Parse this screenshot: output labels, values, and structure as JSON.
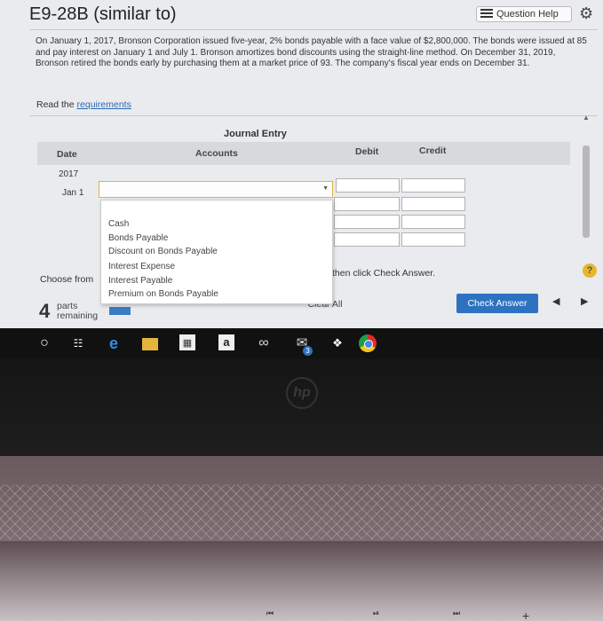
{
  "title": "E9-28B (similar to)",
  "question_help": "Question Help",
  "problem_text": "On January 1, 2017, Bronson Corporation issued five-year, 2% bonds payable with a face value of $2,800,000. The bonds were issued at 85 and pay interest on January 1 and July 1. Bronson amortizes bond discounts using the straight-line method. On December 31, 2019, Bronson retired the bonds early by purchasing them at a market price of 93. The company's fiscal year ends on December 31.",
  "read_prefix": "Read the",
  "read_link": "requirements",
  "journal": {
    "title": "Journal Entry",
    "col_date": "Date",
    "col_accounts": "Accounts",
    "col_debit": "Debit",
    "col_credit": "Credit",
    "year": "2017",
    "date": "Jan 1"
  },
  "dropdown_options": [
    "Cash",
    "Bonds Payable",
    "Discount on Bonds Payable",
    "Interest Expense",
    "Interest Payable",
    "Premium on Bonds Payable"
  ],
  "choose_from": "Choose from",
  "then_click": "then click Check Answer.",
  "parts_count": "4",
  "parts_label1": "parts",
  "parts_label2": "remaining",
  "clear_all": "Clear All",
  "check_answer": "Check Answer",
  "taskbar": {
    "amazon_letter": "a",
    "mail_badge": "3"
  },
  "laptop_logo": "hp",
  "accent_color": "#2d72c0",
  "select_border_color": "#e0b240"
}
